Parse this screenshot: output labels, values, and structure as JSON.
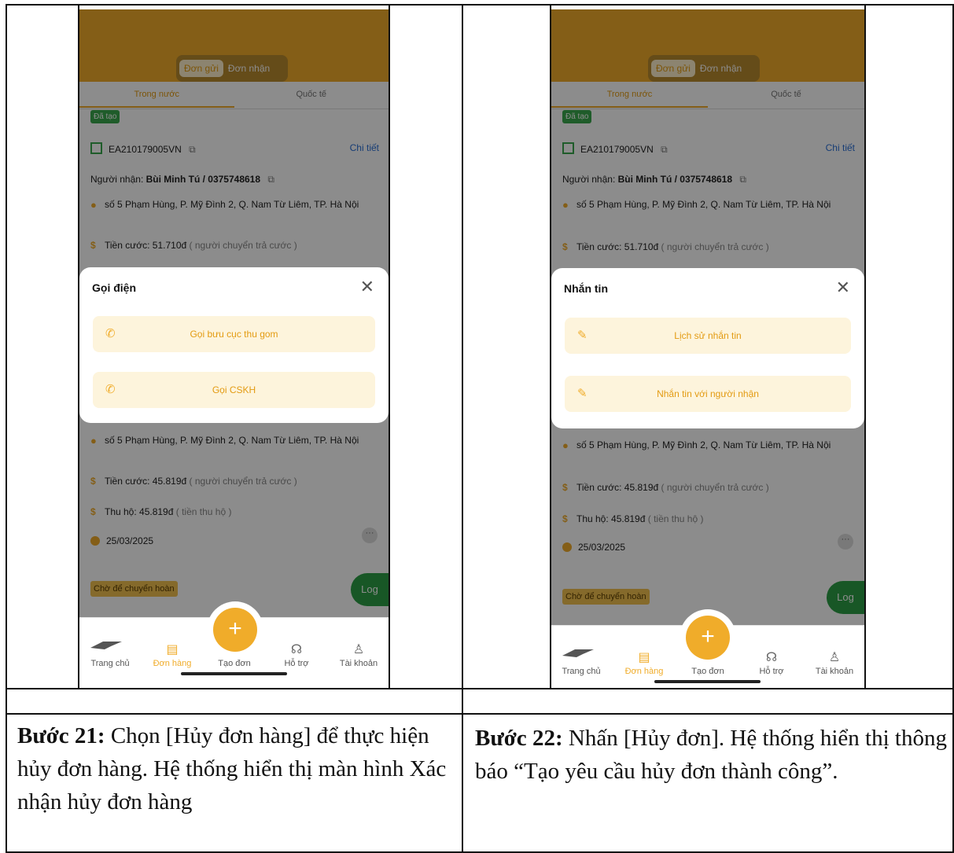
{
  "steps": [
    {
      "caption_step": "Bước 21:",
      "caption_text": "Chọn [Hủy đơn hàng] để thực hiện hủy đơn hàng. Hệ thống hiển thị màn hình Xác nhận hủy đơn hàng",
      "screen": {
        "segment": {
          "active": "Đơn gửi",
          "inactive": "Đơn nhận"
        },
        "subtabs": {
          "active": "Trong nước",
          "inactive": "Quốc tế"
        },
        "status_badge": "Đã tạo",
        "order_code": "EA210179005VN",
        "detail_link": "Chi tiết",
        "recipient_label": "Người nhận:",
        "recipient_value": "Bùi Minh Tú / 0375748618",
        "address": "số 5 Phạm Hùng, P. Mỹ Đình 2, Q. Nam Từ Liêm, TP. Hà Nội",
        "fee": "Tiền cước: 51.710đ",
        "fee_note": "( người chuyển trả cước )",
        "sheet_title": "Gọi điện",
        "option1": "Gọi bưu cục thu gom",
        "option2": "Gọi CSKH",
        "address2": "số 5 Phạm Hùng, P. Mỹ Đình 2, Q. Nam Từ Liêm, TP. Hà Nội",
        "fee2": "Tiền cước: 45.819đ",
        "fee2_note": "( người chuyển trả cước )",
        "cod": "Thu hộ: 45.819đ",
        "cod_note": "( tiền thu hộ )",
        "date": "25/03/2025",
        "pending_badge": "Chờ để chuyển hoàn",
        "log_button": "Log",
        "tabs": [
          "Trang chủ",
          "Đơn hàng",
          "Tạo đơn",
          "Hỗ trợ",
          "Tài khoản"
        ]
      }
    },
    {
      "caption_step": "Bước 22:",
      "caption_text": "Nhấn [Hủy đơn]. Hệ thống hiển thị thông báo “Tạo yêu cầu hủy đơn thành công”.",
      "screen": {
        "segment": {
          "active": "Đơn gửi",
          "inactive": "Đơn nhận"
        },
        "subtabs": {
          "active": "Trong nước",
          "inactive": "Quốc tế"
        },
        "status_badge": "Đã tạo",
        "order_code": "EA210179005VN",
        "detail_link": "Chi tiết",
        "recipient_label": "Người nhận:",
        "recipient_value": "Bùi Minh Tú / 0375748618",
        "address": "số 5 Phạm Hùng, P. Mỹ Đình 2, Q. Nam Từ Liêm, TP. Hà Nội",
        "fee": "Tiền cước: 51.710đ",
        "fee_note": "( người chuyển trả cước )",
        "sheet_title": "Nhắn tin",
        "option1": "Lịch sử nhắn tin",
        "option2": "Nhắn tin với người nhận",
        "address2": "số 5 Phạm Hùng, P. Mỹ Đình 2, Q. Nam Từ Liêm, TP. Hà Nội",
        "fee2": "Tiền cước: 45.819đ",
        "fee2_note": "( người chuyển trả cước )",
        "cod": "Thu hộ: 45.819đ",
        "cod_note": "( tiền thu hộ )",
        "date": "25/03/2025",
        "pending_badge": "Chờ để chuyển hoàn",
        "log_button": "Log",
        "tabs": [
          "Trang chủ",
          "Đơn hàng",
          "Tạo đơn",
          "Hỗ trợ",
          "Tài khoản"
        ]
      }
    }
  ],
  "colors": {
    "brand": "#f0ac2a",
    "success": "#3aa84d",
    "link": "#2a6fd6"
  }
}
